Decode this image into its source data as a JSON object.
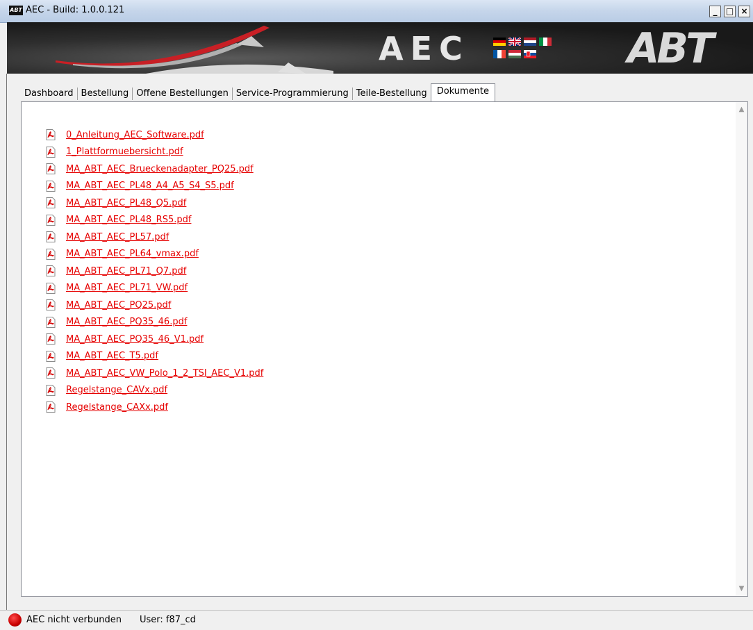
{
  "window": {
    "title": "AEC - Build: 1.0.0.121",
    "app_icon_text": "ABT",
    "minimize_label": "_",
    "maximize_label": "□",
    "close_label": "×"
  },
  "header": {
    "title": "AEC",
    "brand": "ABT",
    "flags": [
      "german-flag",
      "uk-flag",
      "netherlands-flag",
      "italy-flag",
      "france-flag",
      "hungary-flag",
      "slovakia-flag"
    ]
  },
  "tabs": [
    {
      "label": "Dashboard"
    },
    {
      "label": "Bestellung"
    },
    {
      "label": "Offene Bestellungen"
    },
    {
      "label": "Service-Programmierung"
    },
    {
      "label": "Teile-Bestellung"
    },
    {
      "label": "Dokumente",
      "active": true
    }
  ],
  "documents": [
    "0_Anleitung_AEC_Software.pdf",
    "1_Plattformuebersicht.pdf",
    "MA_ABT_AEC_Brueckenadapter_PQ25.pdf",
    "MA_ABT_AEC_PL48_A4_A5_S4_S5.pdf",
    "MA_ABT_AEC_PL48_Q5.pdf",
    "MA_ABT_AEC_PL48_RS5.pdf",
    "MA_ABT_AEC_PL57.pdf",
    "MA_ABT_AEC_PL64_vmax.pdf",
    "MA_ABT_AEC_PL71_Q7.pdf",
    "MA_ABT_AEC_PL71_VW.pdf",
    "MA_ABT_AEC_PQ25.pdf",
    "MA_ABT_AEC_PQ35_46.pdf",
    "MA_ABT_AEC_PQ35_46_V1.pdf",
    "MA_ABT_AEC_T5.pdf",
    "MA_ABT_AEC_VW_Polo_1_2_TSI_AEC_V1.pdf",
    "Regelstange_CAVx.pdf",
    "Regelstange_CAXx.pdf"
  ],
  "status": {
    "connection_text": "AEC nicht verbunden",
    "user_text": "User:  f87_cd"
  },
  "colors": {
    "link": "#e60000",
    "status_disconnected": "#c80000"
  }
}
